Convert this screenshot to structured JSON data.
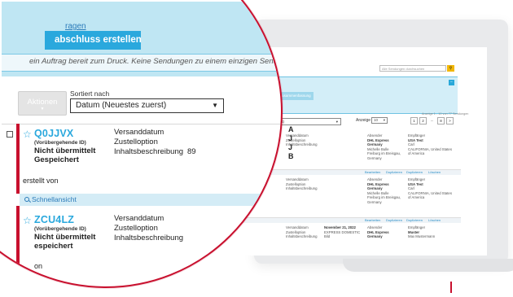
{
  "laptop": {
    "search_placeholder": "Alle Sendungen durchsuchen",
    "banner_btn_a": "Starten",
    "banner_btn_b": "Zusammenfassung",
    "sort_value": "Datum (Neuestes zuerst)",
    "anzeige_label": "Anzeige",
    "anzeige_value": "10",
    "range_text": "Anzeige 1 - 10 von 77 Sendungen",
    "pager": [
      "1",
      "2",
      "...",
      "8",
      ">"
    ],
    "col_versanddatum": "Versanddatum",
    "col_zustelloption": "Zustelloption",
    "col_inhaltsbeschreibung": "Inhaltsbeschreibung",
    "col_absender": "Absender",
    "col_empfaenger": "Empfänger",
    "row1": {
      "sender_company": "DHL Express",
      "sender_country": "Germany",
      "sender_name": "Michelle Bulle",
      "sender_city": "Freiburg im Breisgau,",
      "sender_country2": "Germany",
      "recipient_company": "USA Test",
      "recipient_name": "Carl",
      "recipient_state": "CALIFORNIA, United States",
      "recipient_country": "of America"
    },
    "row3": {
      "date": "November 21, 2022",
      "option": "EXPRESS DOMESTIC",
      "content": "Bild",
      "sender_company": "DHL Express",
      "sender_country": "Germany",
      "recipient_name": "Muster",
      "recipient_full": "Max Mustermann"
    },
    "actions": [
      "Bearbeiten",
      "Duplizieren",
      "Duplizieren",
      "Löschen"
    ],
    "letters": [
      "J",
      "J",
      "B"
    ],
    "letter_a": "A"
  },
  "magnifier": {
    "frages_link": "ragen",
    "create_button": "abschluss erstellen",
    "ready_text": "ein Auftrag bereit zum Druck. Keine Sendungen zu einem einzigen Sendung",
    "aktionen_label": "Aktionen",
    "sort_label": "Sortiert nach",
    "sort_value": "Datum (Neuestes zuerst)",
    "shipments": [
      {
        "id": "Q0JJVX",
        "temp_id_label": "(Vorübergehende ID)",
        "status_line1": "Nicht übermittelt",
        "status_line2": "Gespeichert",
        "created_label": "erstellt von",
        "field1": "Versanddatum",
        "field2": "Zustelloption",
        "field3": "Inhaltsbeschreibung",
        "field3_value": "89"
      },
      {
        "id": "ZCU4LZ",
        "temp_id_label": "(Vorübergehende ID)",
        "status_line1": "Nicht übermittelt",
        "status_line2": "espeichert",
        "created_label": "on",
        "field1": "Versanddatum",
        "field2": "Zustelloption",
        "field3": "Inhaltsbeschreibung"
      }
    ],
    "quick_view": "Schnellansicht"
  },
  "colors": {
    "brand_red": "#c8102e",
    "accent_blue": "#2aa8dd",
    "banner_blue": "#bfe6f3",
    "search_yellow": "#f2b705"
  }
}
